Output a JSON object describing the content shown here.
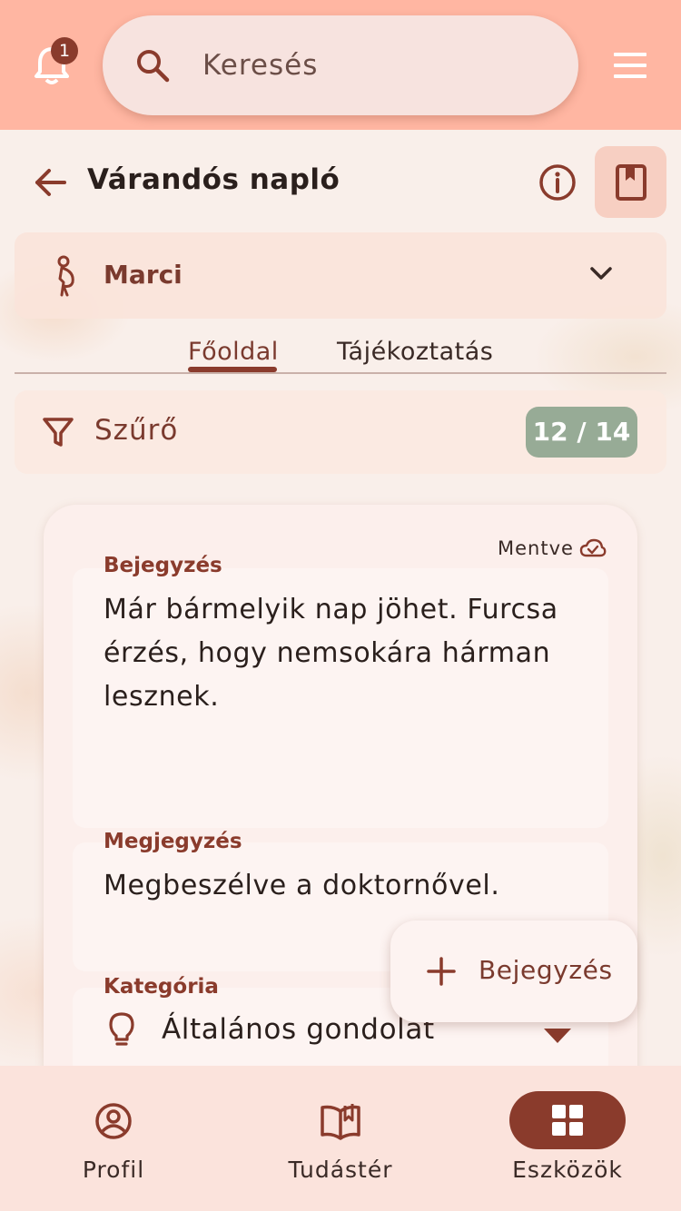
{
  "topbar": {
    "notification_count": "1",
    "search_placeholder": "Keresés"
  },
  "header": {
    "title": "Várandós napló"
  },
  "profile": {
    "name": "Marci"
  },
  "tabs": [
    {
      "label": "Főoldal",
      "active": true
    },
    {
      "label": "Tájékoztatás",
      "active": false
    }
  ],
  "filter": {
    "label": "Szűrő",
    "count": "12 / 14"
  },
  "entry": {
    "saved_label": "Mentve",
    "entry_label": "Bejegyzés",
    "entry_text": "Már bármelyik nap jöhet. Furcsa érzés, hogy nemsokára hárman lesznek.",
    "note_label": "Megjegyzés",
    "note_text": "Megbeszélve a doktornővel.",
    "category_label": "Kategória",
    "category_value": "Általános gondolat"
  },
  "fab": {
    "label": "Bejegyzés"
  },
  "bottom_nav": [
    {
      "label": "Profil",
      "icon": "profile-icon",
      "active": false
    },
    {
      "label": "Tudástér",
      "icon": "book-open-icon",
      "active": false
    },
    {
      "label": "Eszközök",
      "icon": "grid-icon",
      "active": true
    }
  ],
  "colors": {
    "topbar": "#ffb6a2",
    "accent": "#8a3b2c",
    "badge_green": "#97ab96"
  }
}
